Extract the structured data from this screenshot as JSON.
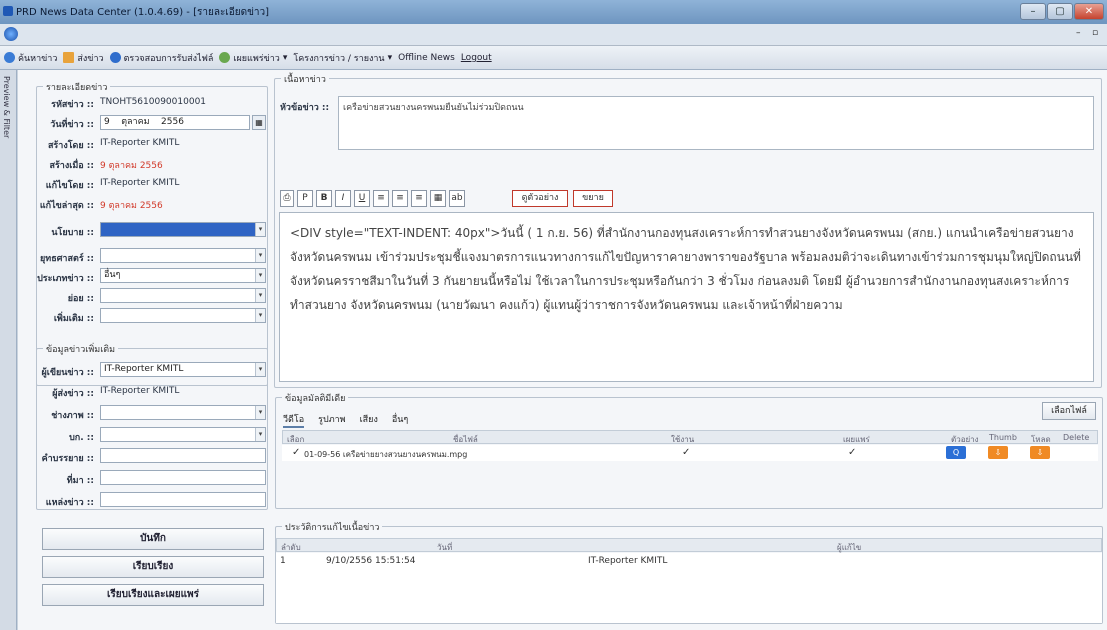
{
  "window": {
    "title": "PRD News Data Center (1.0.4.69) - [รายละเอียดข่าว]",
    "minimize": "–",
    "maximize": "▢",
    "close": "✕",
    "inner_min": "–",
    "inner_max": "▫"
  },
  "toolbar": {
    "items": [
      "ค้นหาข่าว",
      "ส่งข่าว",
      "ตรวจสอบการรับส่งไฟล์",
      "เผยแพร่ข่าว",
      "โครงการข่าว / รายงาน",
      "Offline News",
      "Logout"
    ]
  },
  "side_strip": {
    "label": "Preview & Filter"
  },
  "details": {
    "group_label": "รายละเอียดข่าว",
    "news_id_label": "รหัสข่าว ::",
    "news_id": "TNOHT5610090010001",
    "date_label": "วันที่ข่าว ::",
    "date_day": "9",
    "date_month": "ตุลาคม",
    "date_year": "2556",
    "created_by_label": "สร้างโดย ::",
    "created_by": "IT-Reporter KMITL",
    "created_on_label": "สร้างเมื่อ ::",
    "created_on": "9 ตุลาคม 2556",
    "edited_by_label": "แก้ไขโดย ::",
    "edited_by": "IT-Reporter KMITL",
    "edited_last_label": "แก้ไขล่าสุด ::",
    "edited_last": "9 ตุลาคม 2556",
    "policy_label": "นโยบาย ::",
    "policy": "",
    "strategy_label": "ยุทธศาสตร์ ::",
    "strategy": "",
    "type_label": "ประเภทข่าว ::",
    "type": "อื่นๆ",
    "sub_label": "ย่อย ::",
    "sub": "",
    "extra_label": "เพิ่มเติม ::",
    "extra": ""
  },
  "additional": {
    "group_label": "ข้อมูลข่าวเพิ่มเติม",
    "writer_label": "ผู้เขียนข่าว ::",
    "writer": "IT-Reporter KMITL",
    "sender_label": "ผู้ส่งข่าว ::",
    "sender": "IT-Reporter KMITL",
    "photographer_label": "ช่างภาพ ::",
    "photographer": "",
    "editor_label": "บก. ::",
    "editor": "",
    "narrator_label": "คำบรรยาย ::",
    "narrator": "",
    "source_label": "ที่มา ::",
    "source": "",
    "origin_label": "แหล่งข่าว ::",
    "origin": ""
  },
  "actions": {
    "save": "บันทึก",
    "edit": "เรียบเรียง",
    "edit_publish": "เรียบเรียงและเผยแพร่"
  },
  "content": {
    "group_label": "เนื้อหาข่าว",
    "headline_label": "หัวข้อข่าว ::",
    "headline": "เครือข่ายสวนยางนครพนมยืนยันไม่ร่วมปิดถนน",
    "editor_buttons": [
      "⎙",
      "P",
      "B",
      "I",
      "U",
      "≡",
      "≡",
      "≡",
      "▦",
      "ab"
    ],
    "preview_btn": "ดูตัวอย่าง",
    "expand_btn": "ขยาย",
    "body": "<DIV style=\"TEXT-INDENT: 40px\">วันนี้ ( 1 ก.ย. 56) ที่สำนักงานกองทุนสงเคราะห์การทำสวนยางจังหวัดนครพนม (สกย.) แกนนำเครือข่ายสวนยางจังหวัดนครพนม เข้าร่วมประชุมชี้แจงมาตรการแนวทางการแก้ไขปัญหาราคายางพาราของรัฐบาล พร้อมลงมติว่าจะเดินทางเข้าร่วมการชุมนุมใหญ่ปิดถนนที่จังหวัดนครราชสีมาในวันที่ 3 กันยายนนี้หรือไม่ ใช้เวลาในการประชุมหรือกันกว่า 3 ชั่วโมง ก่อนลงมติ โดยมี ผู้อำนวยการสำนักงานกองทุนสงเคราะห์การทำสวนยาง จังหวัดนครพนม (นายวัฒนา คงแก้ว) ผู้แทนผู้ว่าราชการจังหวัดนครพนม และเจ้าหน้าที่ฝ่ายความ"
  },
  "media": {
    "group_label": "ข้อมูลมัลติมีเดีย",
    "tabs": [
      "วีดีโอ",
      "รูปภาพ",
      "เสียง",
      "อื่นๆ"
    ],
    "choose_file": "เลือกไฟล์",
    "columns": [
      "เลือก",
      "ชื่อไฟล์",
      "ใช้งาน",
      "เผยแพร่",
      "ตัวอย่าง",
      "Thumb",
      "โหลด",
      "Delete"
    ],
    "rows": [
      {
        "checked": "✓",
        "filename": "01-09-56 เครือข่ายยางสวนยางนครพนม.mpg",
        "active": "✓",
        "published": "✓"
      }
    ]
  },
  "history": {
    "group_label": "ประวัติการแก้ไขเนื้อข่าว",
    "columns": [
      "ลำดับ",
      "วันที่",
      "ผู้แก้ไข"
    ],
    "rows": [
      {
        "no": "1",
        "date": "9/10/2556 15:51:54",
        "user": "IT-Reporter KMITL"
      }
    ]
  }
}
